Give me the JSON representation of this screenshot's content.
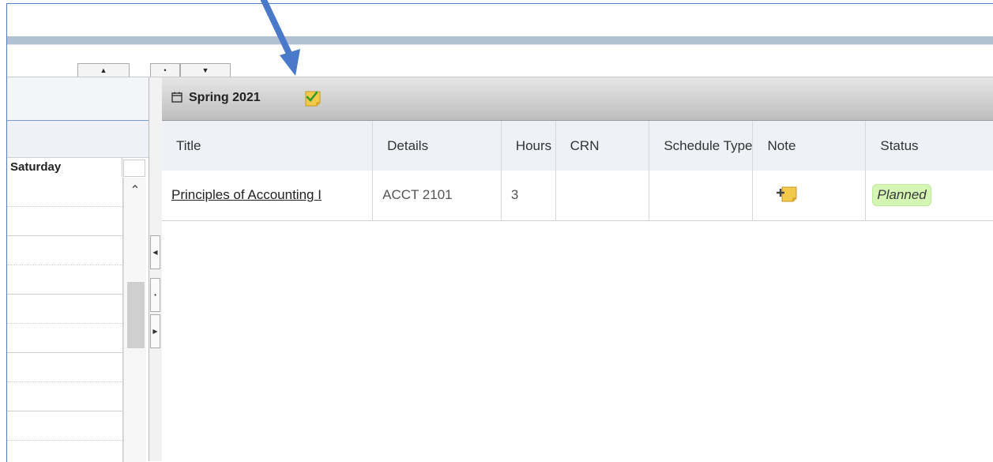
{
  "semester": {
    "title": "Spring 2021"
  },
  "calendar": {
    "day_header": "Saturday"
  },
  "table": {
    "headers": [
      "Title",
      "Details",
      "Hours",
      "CRN",
      "Schedule Type",
      "Note",
      "Status"
    ],
    "rows": [
      {
        "title": "Principles of Accounting I",
        "details": "ACCT 2101",
        "hours": "3",
        "crn": "",
        "schedule": "",
        "status": "Planned"
      }
    ]
  },
  "colors": {
    "arrow": "#4a79c9",
    "status_planned_bg": "#d4f5b4",
    "header_bar": "#b2c0d3"
  },
  "icons": [
    "calendar-icon",
    "note-check-icon",
    "add-note-icon",
    "scroll-up-icon",
    "arrow-annotation"
  ]
}
